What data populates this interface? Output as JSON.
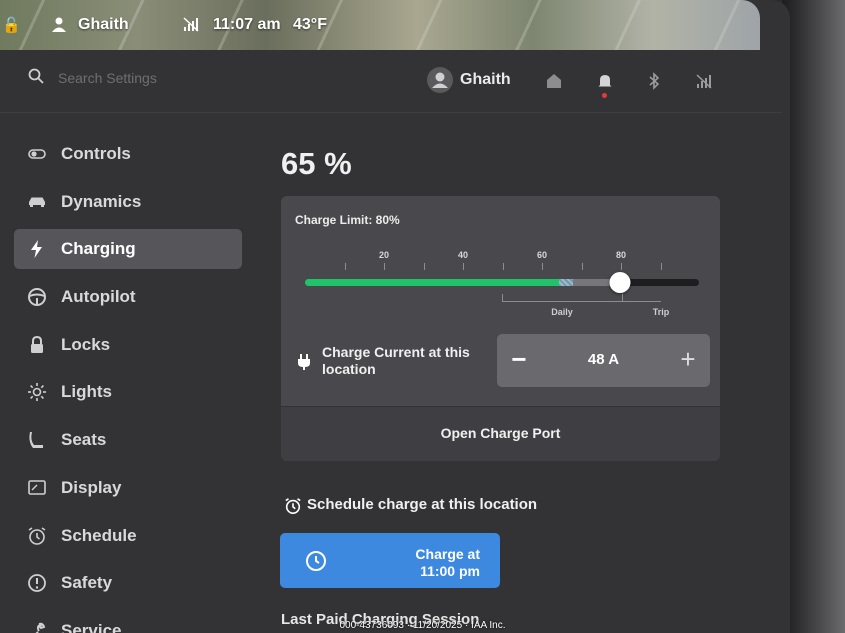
{
  "status_bar": {
    "user": "Ghaith",
    "time": "11:07 am",
    "temperature": "43°F"
  },
  "header": {
    "search_placeholder": "Search Settings",
    "user": "Ghaith"
  },
  "sidebar": {
    "items": [
      {
        "label": "Controls",
        "icon": "toggle-icon"
      },
      {
        "label": "Dynamics",
        "icon": "car-icon"
      },
      {
        "label": "Charging",
        "icon": "lightning-icon",
        "active": true
      },
      {
        "label": "Autopilot",
        "icon": "steering-wheel-icon"
      },
      {
        "label": "Locks",
        "icon": "lock-icon"
      },
      {
        "label": "Lights",
        "icon": "sun-icon"
      },
      {
        "label": "Seats",
        "icon": "seat-icon"
      },
      {
        "label": "Display",
        "icon": "display-icon"
      },
      {
        "label": "Schedule",
        "icon": "alarm-clock-icon"
      },
      {
        "label": "Safety",
        "icon": "alert-icon"
      },
      {
        "label": "Service",
        "icon": "wrench-icon"
      }
    ]
  },
  "charging": {
    "battery_percent": "65 %",
    "charge_limit_label": "Charge Limit: 80%",
    "current_charge_fraction": 0.65,
    "charge_limit_fraction": 0.8,
    "ticks": [
      "20",
      "40",
      "60",
      "80"
    ],
    "daily_label": "Daily",
    "trip_label": "Trip",
    "charge_current_label": "Charge Current at this location",
    "charge_current_value": "48 A",
    "minus_label": "−",
    "plus_label": "+",
    "open_port_label": "Open Charge Port",
    "fill_color": "#1fc46a",
    "schedule_title": "Schedule charge at this location",
    "schedule_button_line1": "Charge at",
    "schedule_button_line2": "11:00 pm",
    "schedule_button_color": "#3e89e0",
    "last_session_label": "Last Paid Charging Session"
  },
  "watermark": "000-43736093 · 11/20/2025 · IAA Inc."
}
